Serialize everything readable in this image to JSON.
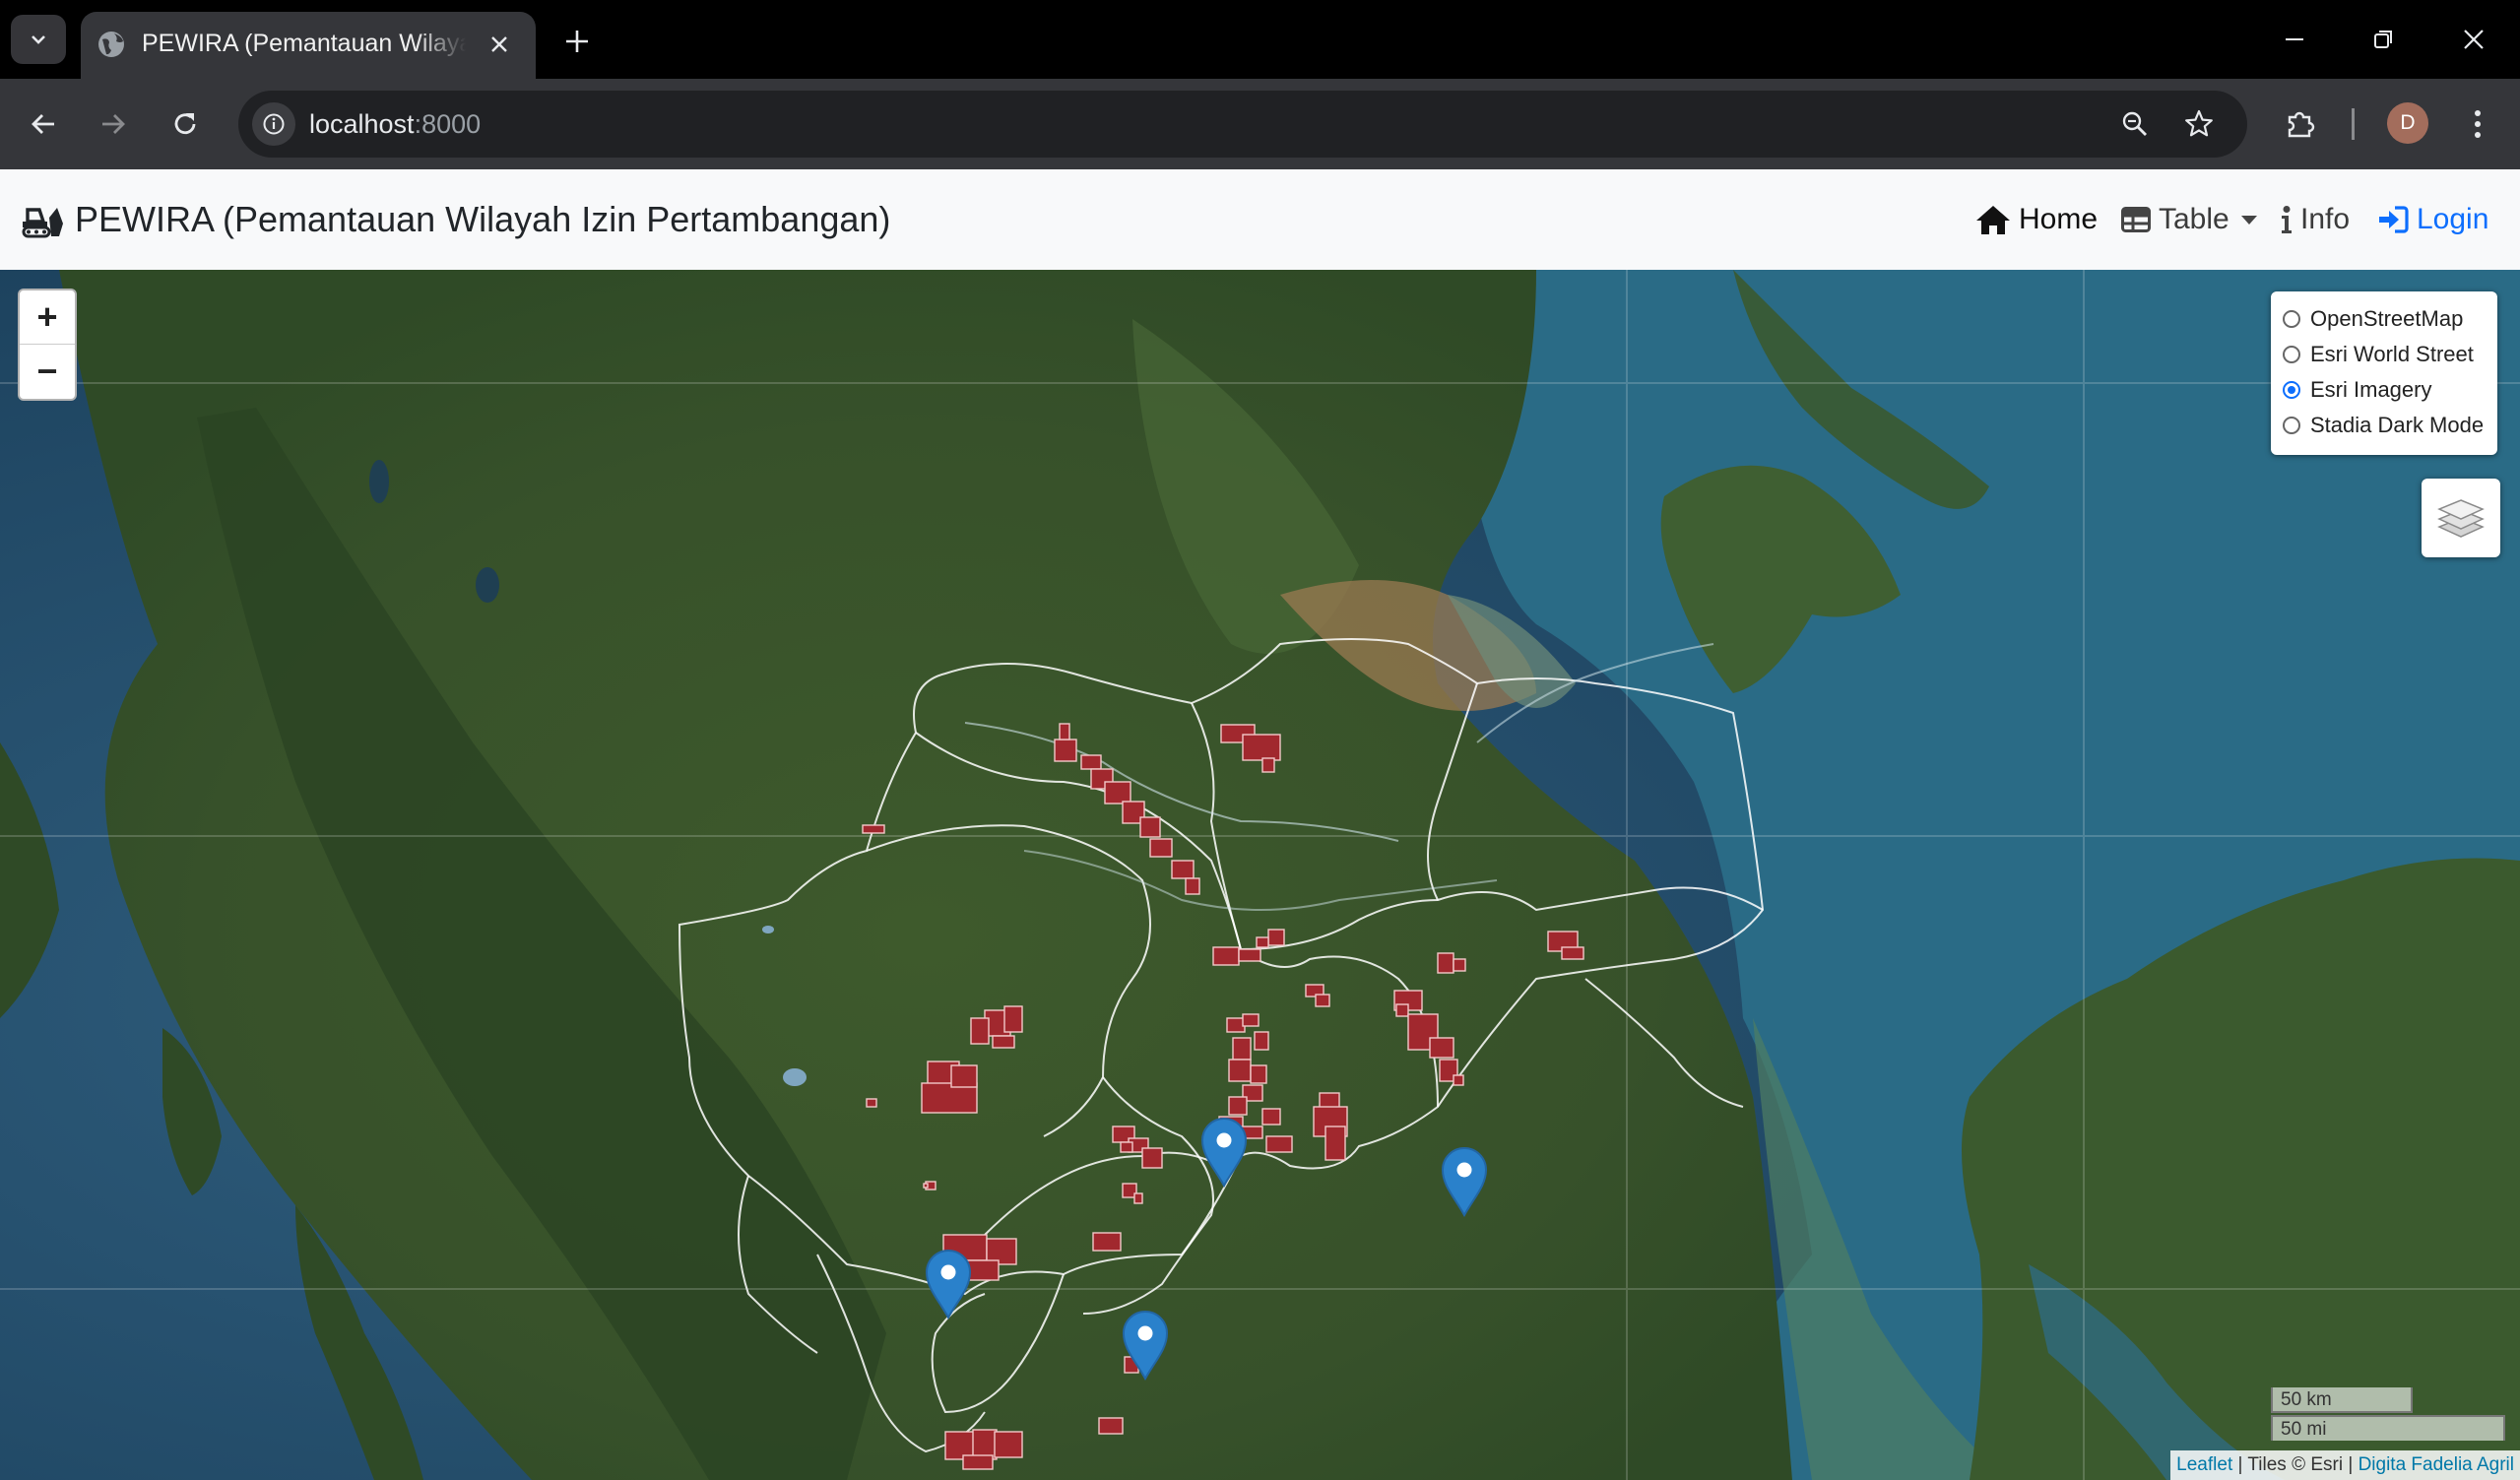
{
  "browser": {
    "tab_title": "PEWIRA (Pemantauan Wilayah Izin Pertambangan)",
    "url_host": "localhost",
    "url_port": ":8000",
    "profile_initial": "D"
  },
  "app": {
    "brand": "PEWIRA (Pemantauan Wilayah Izin Pertambangan)",
    "nav": {
      "home": "Home",
      "table": "Table",
      "info": "Info",
      "login": "Login"
    },
    "accent_color": "#0d6efd"
  },
  "map": {
    "basemaps": [
      {
        "label": "OpenStreetMap",
        "selected": false
      },
      {
        "label": "Esri World Street",
        "selected": false
      },
      {
        "label": "Esri Imagery",
        "selected": true
      },
      {
        "label": "Stadia Dark Mode",
        "selected": false
      }
    ],
    "zoom_in": "+",
    "zoom_out": "−",
    "scale_metric": "50 km",
    "scale_imperial": "50 mi",
    "attribution": {
      "leaflet": "Leaflet",
      "tiles": "Tiles © Esri",
      "author": "Digita Fadelia Agril"
    },
    "marker_count": 4,
    "concession_color": "#a1282e",
    "boundary_color": "#ffffff"
  }
}
